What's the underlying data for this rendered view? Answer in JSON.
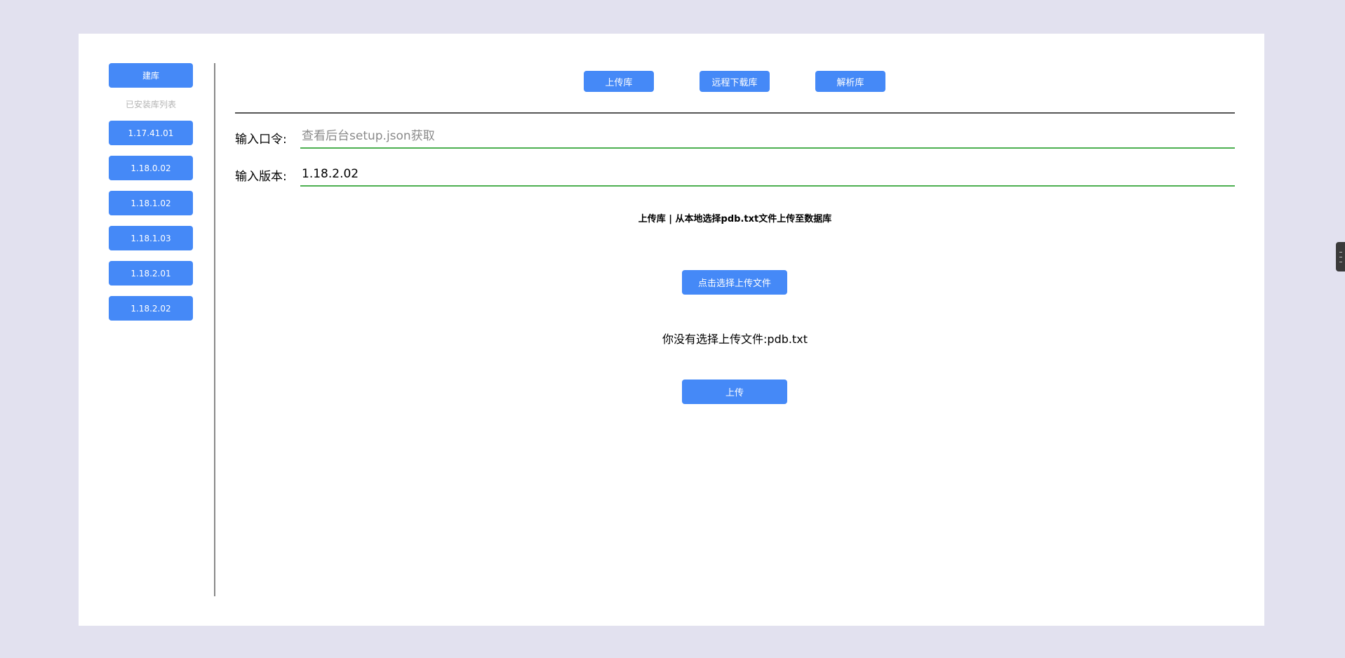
{
  "sidebar": {
    "create_label": "建库",
    "caption": "已安装库列表",
    "versions": [
      "1.17.41.01",
      "1.18.0.02",
      "1.18.1.02",
      "1.18.1.03",
      "1.18.2.01",
      "1.18.2.02"
    ]
  },
  "tabs": {
    "upload": "上传库",
    "remote_download": "远程下载库",
    "parse": "解析库"
  },
  "form": {
    "password_label": "输入口令:",
    "password_placeholder": "查看后台setup.json获取",
    "password_value": "",
    "version_label": "输入版本:",
    "version_value": "1.18.2.02"
  },
  "main": {
    "description": "上传库 | 从本地选择pdb.txt文件上传至数据库",
    "choose_file_label": "点击选择上传文件",
    "status_text": "你没有选择上传文件:pdb.txt",
    "upload_label": "上传"
  },
  "colors": {
    "accent": "#4589f7",
    "input_underline": "#4caf50",
    "page_background": "#e2e1ef"
  }
}
